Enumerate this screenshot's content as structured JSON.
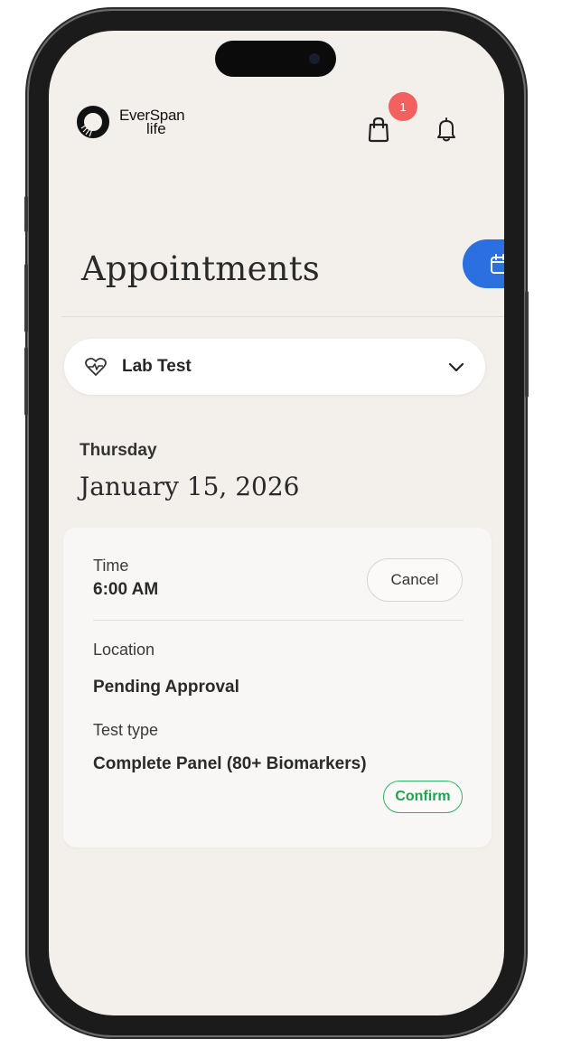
{
  "header": {
    "brand_line1": "EverSpan",
    "brand_line2": "life",
    "cart_badge_count": "1"
  },
  "page": {
    "title": "Appointments"
  },
  "selector": {
    "value": "Lab Test"
  },
  "appointment": {
    "day": "Thursday",
    "date": "January 15, 2026",
    "time_label": "Time",
    "time_value": "6:00 AM",
    "cancel_label": "Cancel",
    "location_label": "Location",
    "location_value": "Pending Approval",
    "test_type_label": "Test type",
    "test_type_value": "Complete Panel (80+ Biomarkers)",
    "confirm_label": "Confirm"
  },
  "colors": {
    "background": "#f3efeb",
    "accent_blue": "#2b6fe0",
    "badge_red": "#f26060",
    "confirm_green": "#2db55d"
  },
  "icons": {
    "brand": "everspan-logo-icon",
    "cart": "shopping-bag-icon",
    "notifications": "bell-icon",
    "calendar": "calendar-icon",
    "lab": "heart-pulse-icon",
    "dropdown": "chevron-down-icon"
  }
}
